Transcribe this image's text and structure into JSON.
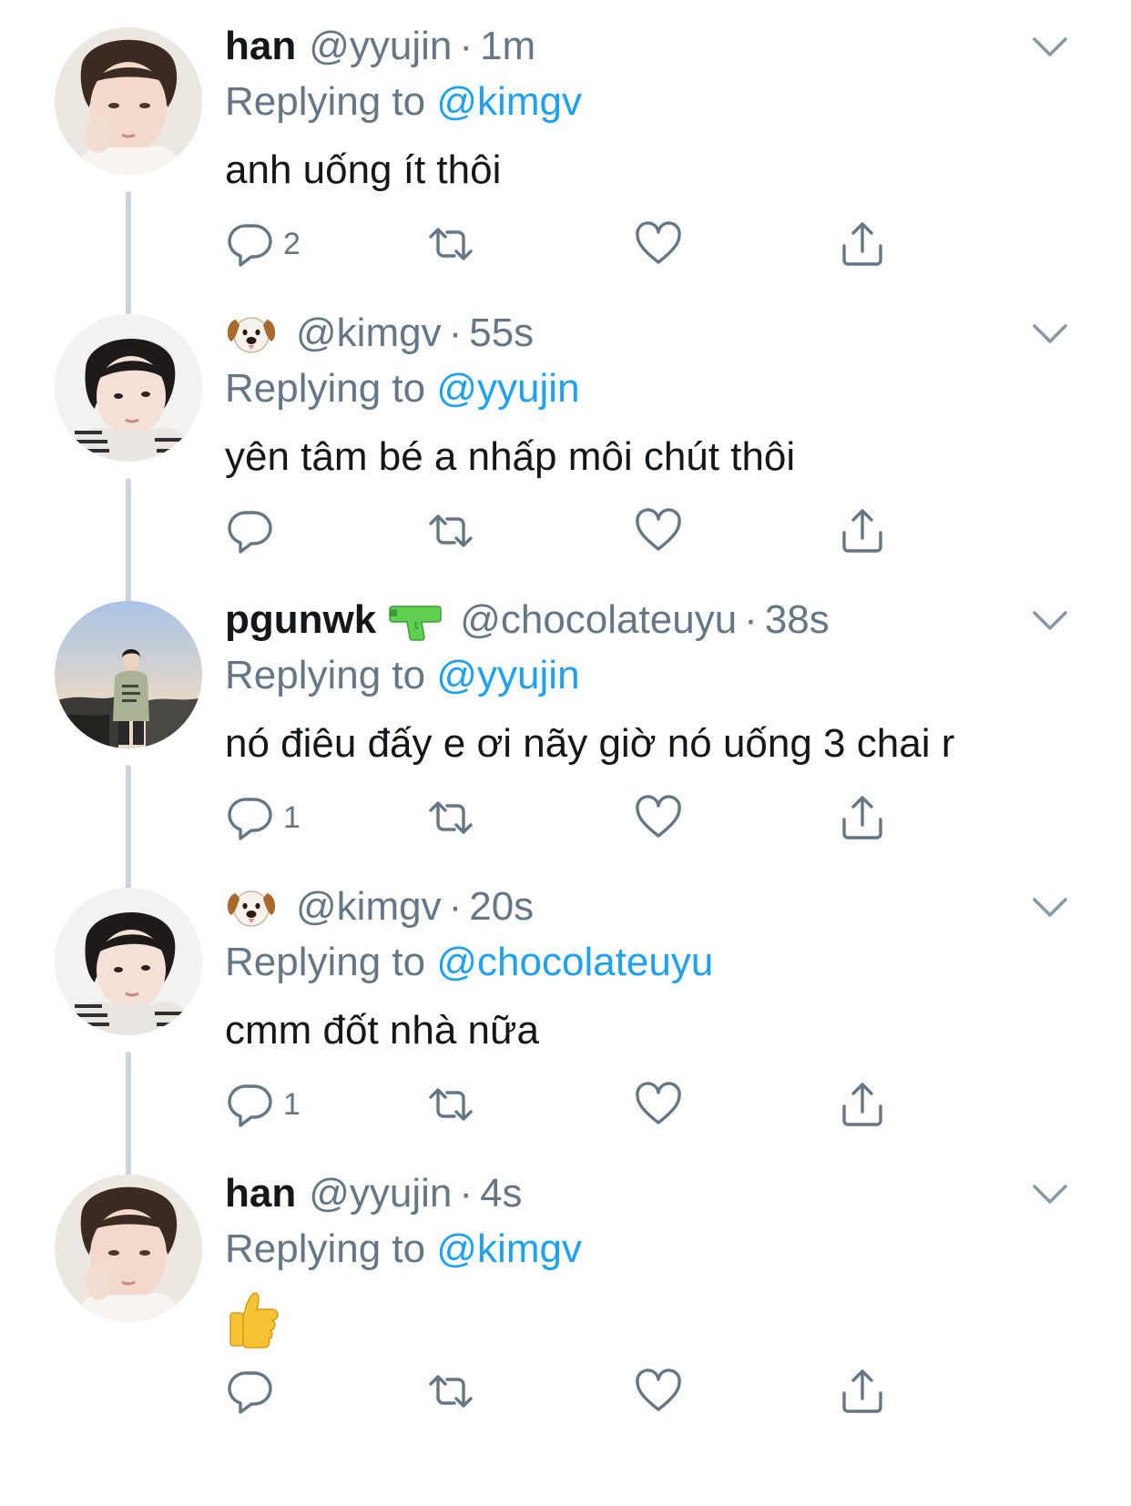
{
  "tweets": [
    {
      "display_name": "han",
      "handle": "@yyujin",
      "separator": "·",
      "time": "1m",
      "replying_label": "Replying to",
      "replying_to": "@kimgv",
      "text": "anh uống ít thôi",
      "reply_count": "2",
      "badge_icon": "",
      "avatar_icon": "avatar-photo-han"
    },
    {
      "display_name": "",
      "handle": "@kimgv",
      "separator": "·",
      "time": "55s",
      "replying_label": "Replying to",
      "replying_to": "@yyujin",
      "text": "yên tâm bé a nhấp môi chút thôi",
      "reply_count": "",
      "badge_icon": "dog-face-emoji",
      "avatar_icon": "avatar-photo-kimgv"
    },
    {
      "display_name": "pgunwk",
      "handle": "@chocolateuyu",
      "separator": "·",
      "time": "38s",
      "replying_label": "Replying to",
      "replying_to": "@yyujin",
      "text": "nó điêu đấy e ơi nãy giờ nó uống 3 chai r",
      "reply_count": "1",
      "badge_icon": "water-pistol-emoji",
      "avatar_icon": "avatar-photo-pgunwk"
    },
    {
      "display_name": "",
      "handle": "@kimgv",
      "separator": "·",
      "time": "20s",
      "replying_label": "Replying to",
      "replying_to": "@chocolateuyu",
      "text": "cmm đốt nhà nữa",
      "reply_count": "1",
      "badge_icon": "dog-face-emoji",
      "avatar_icon": "avatar-photo-kimgv"
    },
    {
      "display_name": "han",
      "handle": "@yyujin",
      "separator": "·",
      "time": "4s",
      "replying_label": "Replying to",
      "replying_to": "@kimgv",
      "text": "",
      "reply_count": "",
      "badge_icon": "",
      "body_icon": "thumbs-up-emoji",
      "avatar_icon": "avatar-photo-han"
    }
  ],
  "actions": {
    "reply_icon": "reply-icon",
    "retweet_icon": "retweet-icon",
    "like_icon": "heart-icon",
    "share_icon": "share-icon",
    "menu_icon": "chevron-down-icon"
  },
  "colors": {
    "text": "#14171a",
    "secondary": "#657786",
    "link": "#1da1f2",
    "thread_line": "#cdd6dd"
  }
}
